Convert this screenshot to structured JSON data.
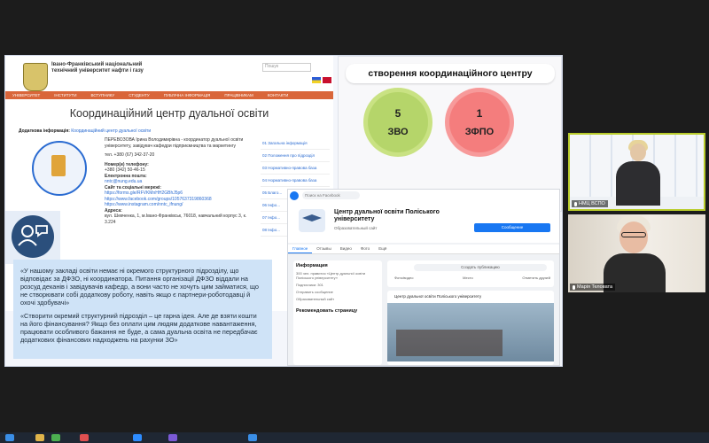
{
  "site": {
    "uni_name": "Івано-Франківський національний технічний університет нафти і газу",
    "search_placeholder": "Пошук",
    "nav": [
      "УНІВЕРСИТЕТ",
      "ІНСТИТУТИ",
      "ВСТУПНИКУ",
      "СТУДЕНТУ",
      "ПУБЛІЧНА ІНФОРМАЦІЯ",
      "ПРАЦІВНИКАМ",
      "КОНТАКТИ"
    ],
    "page_title": "Координаційний центр дуальної освіти",
    "addinfo_label": "Додаткова інформація:",
    "addinfo_link": "Координаційний центр дуальної освіти",
    "contact_person": "ПЕРЕВОЗОВА Ірина Володимирівна - координатор дуальної освіти університету, завідувач кафедри підприємництва та маркетингу",
    "phone": "тел. +380 (67) 342-37-20",
    "details": [
      "Номер(и) телефону:",
      "+380 (342) 50-46-15",
      "Електронна пошта:",
      "nntc@nung.edu.ua",
      "Сайт та соціальні мережі:",
      "https://forms.gle/RFVKMnHH2GBhJ5p6",
      "https://www.facebook.com/groups/1057637319860368",
      "https://www.instagram.com/nntc_ifnung/",
      "Адреса:",
      "вул. Шевченка, 1, м.Івано-Франківськ, 76018, навчальний корпус 3, к. 3.224"
    ],
    "sidebar": [
      "01 Загальна інформація",
      "02 Положення про підрозділ",
      "03 Нормативно-правова база",
      "04 Нормативно-правова база",
      "05 Благо...",
      "06 Інфо...",
      "07 Інфо...",
      "08 Інфо..."
    ]
  },
  "quote": {
    "p1": "«У нашому закладі освіти немає ні окремого структурного підрозділу, що відповідає за ДФЗО, ні координатора. Питання організації ДФЗО віддали на розсуд деканів і завідувачів кафедр, а вони часто не хочуть цим займатися, що не створювати собі додаткову роботу, навіть якщо є партнери-роботодавці й охочі здобувачі»",
    "p2": "«Створити окремий структурний підрозділ – це гарна ідея. Але де взяти кошти на його фінансування? Якщо без оплати цим людям додаткове навантаження, працювати особливого бажання не буде, а сама дуальна освіта не передбачає додаткових фінансових надходжень на рахунки ЗО»"
  },
  "boxes": {
    "heading": "створення координаційного центру",
    "b1": {
      "num": "5",
      "label": "ЗВО",
      "color": "#b5d56a"
    },
    "b2": {
      "num": "1",
      "label": "ЗФПО",
      "color": "#f47d7d"
    }
  },
  "facebook": {
    "search": "Поиск на Facebook",
    "page_name": "Центр дуальної освіти Поліського університету",
    "page_type": "Образовательный сайт",
    "message_btn": "Сообщение",
    "tabs": [
      "Главное",
      "Отзывы",
      "Видео",
      "Фото",
      "Ещё"
    ],
    "info_header": "Информация",
    "info_rows": [
      "300 чел. нравится «Центр дуальної освіти Поліського університету»",
      "Подписчики: 301",
      "Отправить сообщение",
      "Образовательный сайт"
    ],
    "recommend": "Рекомендовать страницу",
    "create_post": "Создать публикацию",
    "post_actions": [
      "Фото/видео",
      "Место",
      "Отметить друзей"
    ],
    "post_title": "Центр дуальної освіти Поліського університету"
  },
  "participants": [
    {
      "name": "НМЦ ВСПО"
    },
    {
      "name": "Марія Теловата"
    }
  ]
}
